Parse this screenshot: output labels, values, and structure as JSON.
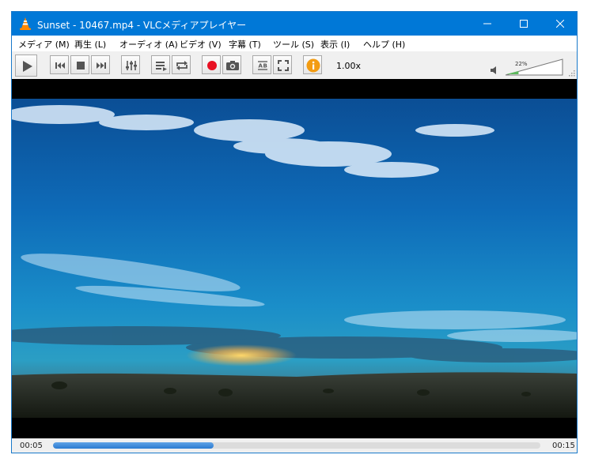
{
  "window": {
    "title": "Sunset - 10467.mp4 - VLCメディアプレイヤー"
  },
  "menu": [
    {
      "id": "media",
      "label": "メディア (M)"
    },
    {
      "id": "playback",
      "label": "再生 (L)"
    },
    {
      "id": "audio",
      "label": "オーディオ (A)"
    },
    {
      "id": "video",
      "label": "ビデオ (V)"
    },
    {
      "id": "subtitle",
      "label": "字幕 (T)"
    },
    {
      "id": "tools",
      "label": "ツール (S)"
    },
    {
      "id": "view",
      "label": "表示 (I)"
    },
    {
      "id": "help",
      "label": "ヘルプ (H)"
    }
  ],
  "toolbar": {
    "buttons": [
      {
        "id": "play",
        "icon": "play-icon"
      },
      {
        "id": "previous",
        "icon": "skip-previous-icon"
      },
      {
        "id": "stop",
        "icon": "stop-icon"
      },
      {
        "id": "next",
        "icon": "skip-next-icon"
      },
      {
        "id": "extended-settings",
        "icon": "equalizer-sliders-icon"
      },
      {
        "id": "playlist",
        "icon": "playlist-icon"
      },
      {
        "id": "loop",
        "icon": "loop-icon"
      },
      {
        "id": "record",
        "icon": "record-icon"
      },
      {
        "id": "snapshot",
        "icon": "camera-icon"
      },
      {
        "id": "ab-loop",
        "icon": "ab-loop-icon"
      },
      {
        "id": "fullscreen",
        "icon": "fullscreen-icon"
      },
      {
        "id": "media-info",
        "icon": "info-icon"
      }
    ],
    "speed": "1.00x",
    "volume": {
      "percent_label": "22%",
      "level": 0.22
    }
  },
  "status": {
    "elapsed": "00:05",
    "total": "00:15",
    "progress": 0.33
  },
  "colors": {
    "titlebar": "#0078d7",
    "accent": "#2b7bd1",
    "record": "#e81123",
    "info": "#f39c12",
    "vlc_orange": "#ff8800"
  }
}
